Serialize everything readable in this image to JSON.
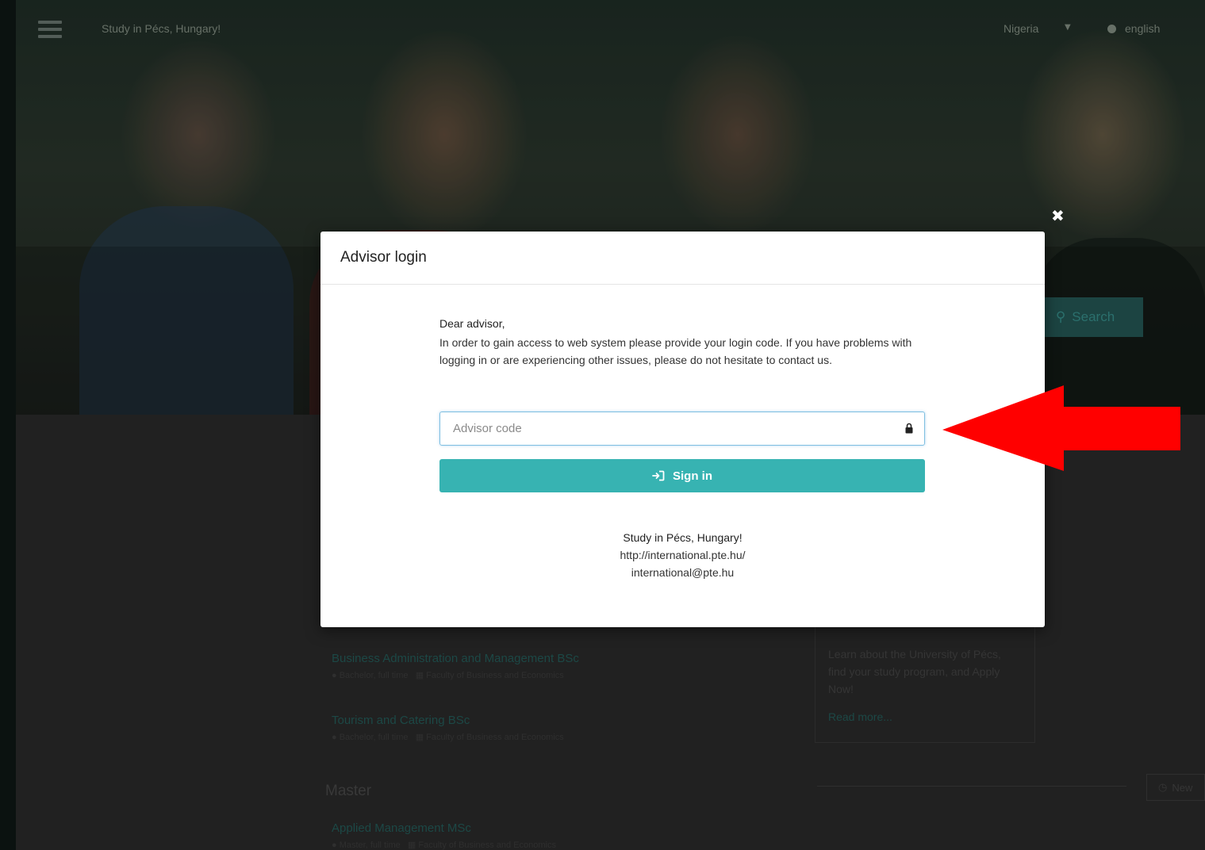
{
  "header": {
    "site_title": "Study in Pécs, Hungary!",
    "country": "Nigeria",
    "language": "english"
  },
  "hero": {
    "search_label": "Search"
  },
  "background_content": {
    "courses": [
      {
        "title": "Business Administration and Management BSc",
        "type": "Bachelor, full time",
        "faculty": "Faculty of Business and Economics"
      },
      {
        "title": "Tourism and Catering BSc",
        "type": "Bachelor, full time",
        "faculty": "Faculty of Business and Economics"
      }
    ],
    "section_master": "Master",
    "master_courses": [
      {
        "title": "Applied Management MSc",
        "type": "Master, full time",
        "faculty": "Faculty of Business and Economics"
      }
    ],
    "side_card": {
      "text": "Learn about the University of Pécs, find your study program, and Apply Now!",
      "read_more": "Read more..."
    },
    "side_new_label": "New"
  },
  "modal": {
    "title": "Advisor login",
    "greeting": "Dear advisor,",
    "message": "In order to gain access to web system please provide your login code. If you have problems with logging in or are experiencing other issues, please do not hesitate to contact us.",
    "code_placeholder": "Advisor code",
    "code_value": "",
    "signin_label": "Sign in",
    "footer_name": "Study in Pécs, Hungary!",
    "footer_url": "http://international.pte.hu/",
    "footer_email": "international@pte.hu"
  },
  "colors": {
    "accent": "#37b3b2",
    "annotation_arrow": "#ff0000"
  }
}
